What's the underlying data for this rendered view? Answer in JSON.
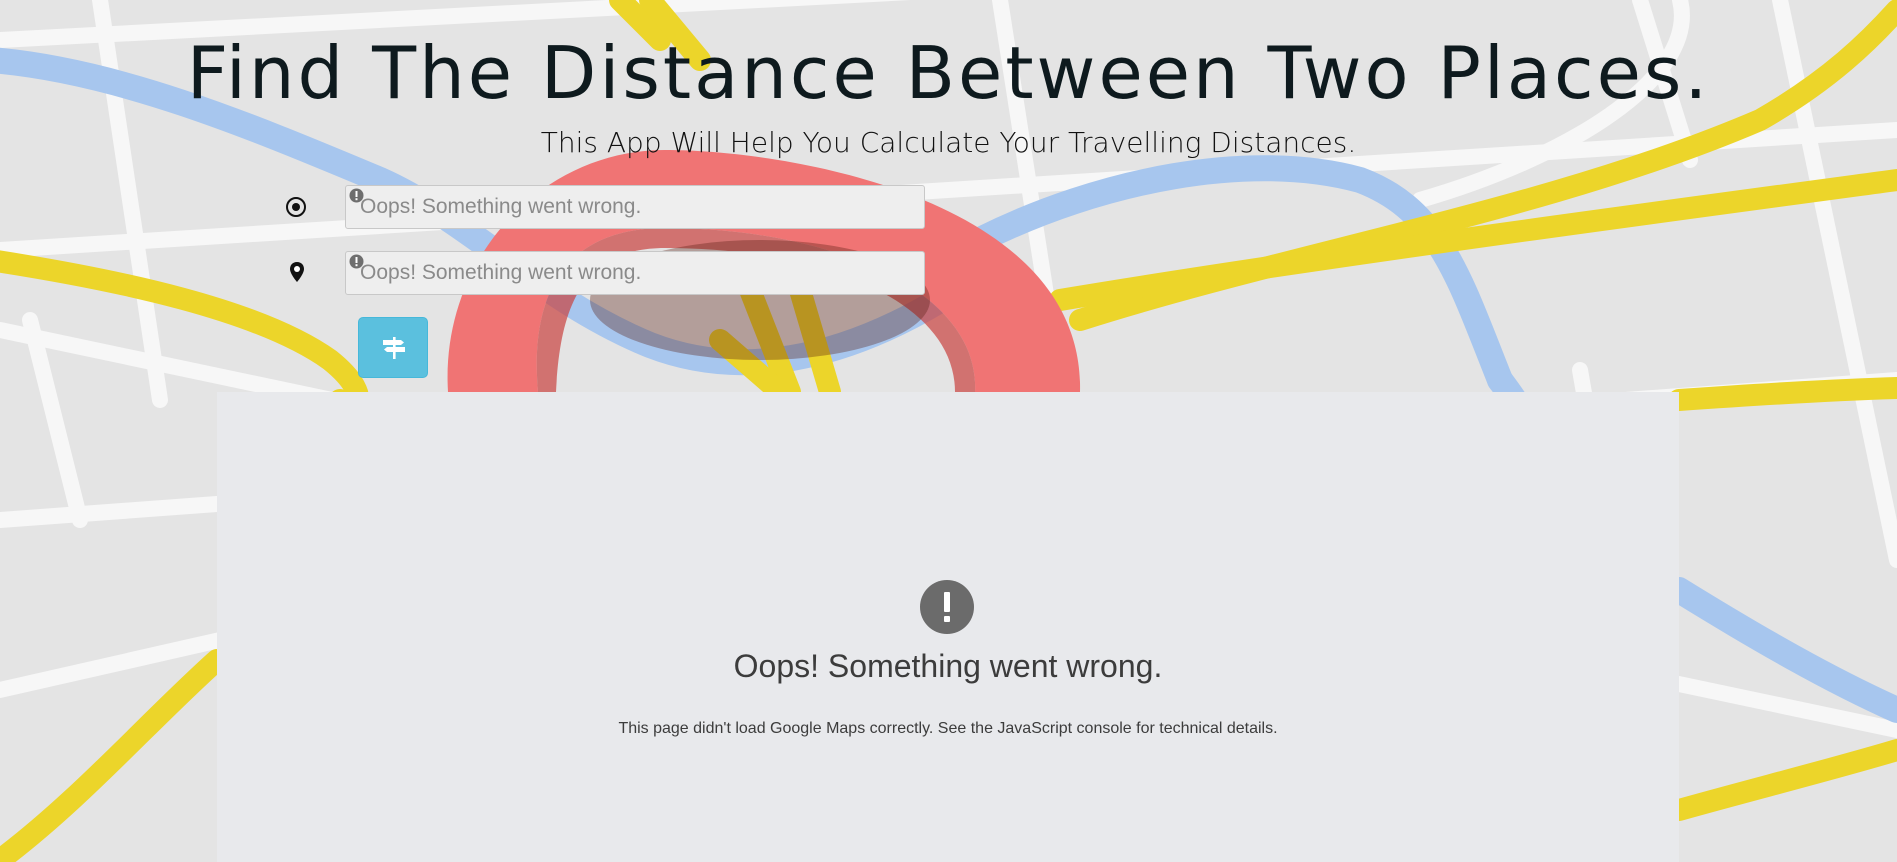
{
  "header": {
    "title": "Find The Distance Between Two Places.",
    "subtitle": "This App Will Help You Calculate Your Travelling Distances."
  },
  "form": {
    "origin": {
      "icon": "origin-target-icon",
      "placeholder": "Oops! Something went wrong.",
      "value": "",
      "error_icon": "error-icon"
    },
    "destination": {
      "icon": "map-pin-icon",
      "placeholder": "Oops! Something went wrong.",
      "value": "",
      "error_icon": "error-icon"
    },
    "route_button": {
      "icon": "signpost-icon",
      "color": "#5bc0de"
    }
  },
  "map": {
    "error_icon": "exclamation-circle-icon",
    "error_title": "Oops! Something went wrong.",
    "error_message": "This page didn't load Google Maps correctly. See the JavaScript console for technical details."
  },
  "colors": {
    "road_yellow": "#ecd52a",
    "road_blue": "#a9c8ee",
    "pin_red": "#f07373",
    "map_panel": "#e8e9ec"
  }
}
